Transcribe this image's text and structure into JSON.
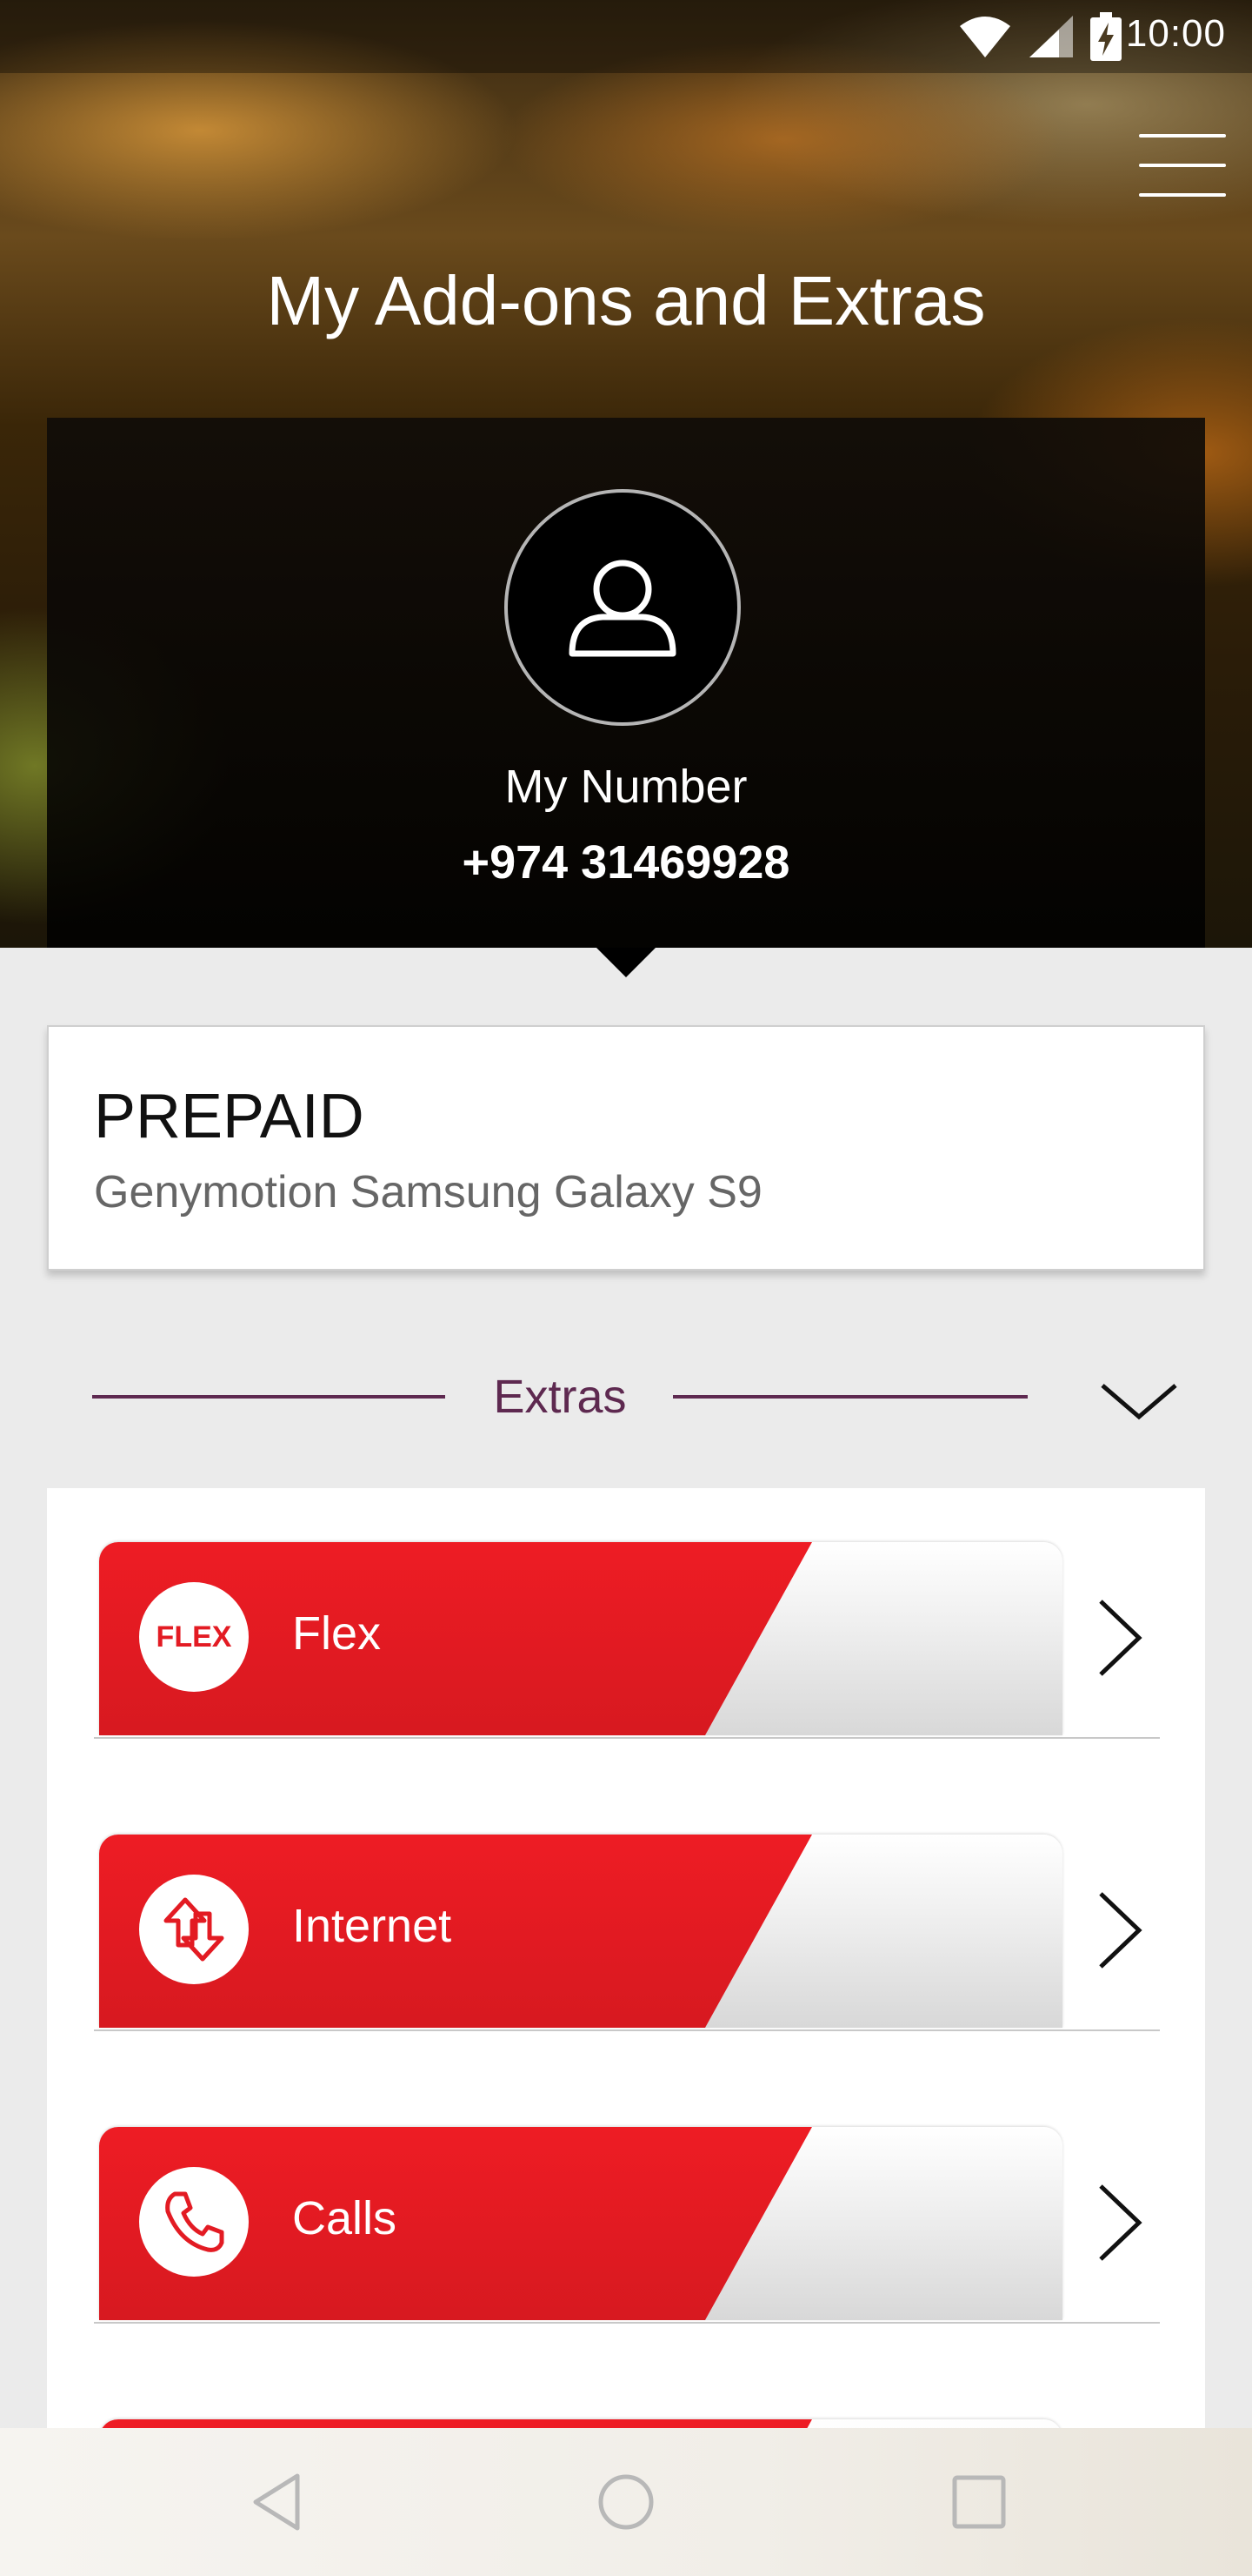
{
  "status_bar": {
    "time": "10:00",
    "icons": [
      "wifi-icon",
      "signal-icon",
      "battery-charging-icon"
    ]
  },
  "header": {
    "title": "My Add-ons and Extras",
    "menu_icon": "hamburger-menu-icon"
  },
  "profile": {
    "avatar_icon": "user-icon",
    "label": "My Number",
    "number": "+974 31469928"
  },
  "plan": {
    "type": "PREPAID",
    "device": "Genymotion Samsung Galaxy S9"
  },
  "extras": {
    "section_label": "Extras",
    "toggle_icon": "chevron-down-icon",
    "accent_color": "#5e2950",
    "items": [
      {
        "label": "Flex",
        "icon": "flex-logo-icon",
        "icon_text": "FLEX"
      },
      {
        "label": "Internet",
        "icon": "data-transfer-icon"
      },
      {
        "label": "Calls",
        "icon": "phone-icon"
      }
    ],
    "item_color": "#e31b23"
  },
  "nav_bar": {
    "buttons": [
      "back-icon",
      "home-icon",
      "recents-icon"
    ]
  }
}
